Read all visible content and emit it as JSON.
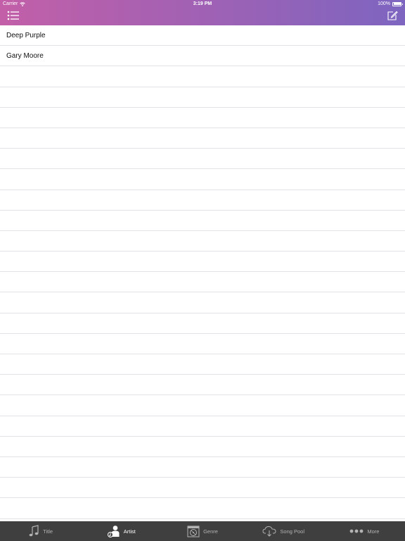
{
  "status": {
    "carrier": "Carrier",
    "time": "3:19 PM",
    "battery": "100%"
  },
  "header": {
    "menu_icon": "list-icon",
    "compose_icon": "compose-icon",
    "gradient": [
      "#c35fa8",
      "#7d65c0"
    ]
  },
  "artists": [
    {
      "name": "Deep Purple"
    },
    {
      "name": "Gary Moore"
    }
  ],
  "tabs": [
    {
      "label": "Title",
      "icon": "music-note-icon",
      "active": false
    },
    {
      "label": "Artist",
      "icon": "artist-icon",
      "active": true
    },
    {
      "label": "Genre",
      "icon": "genre-icon",
      "active": false
    },
    {
      "label": "Song Pool",
      "icon": "cloud-download-icon",
      "active": false
    },
    {
      "label": "More",
      "icon": "more-icon",
      "active": false
    }
  ],
  "colors": {
    "tabbar_bg": "#3f3f3f",
    "tab_inactive": "#b3b3b3",
    "tab_active": "#ffffff",
    "separator": "#e2e2e6"
  }
}
